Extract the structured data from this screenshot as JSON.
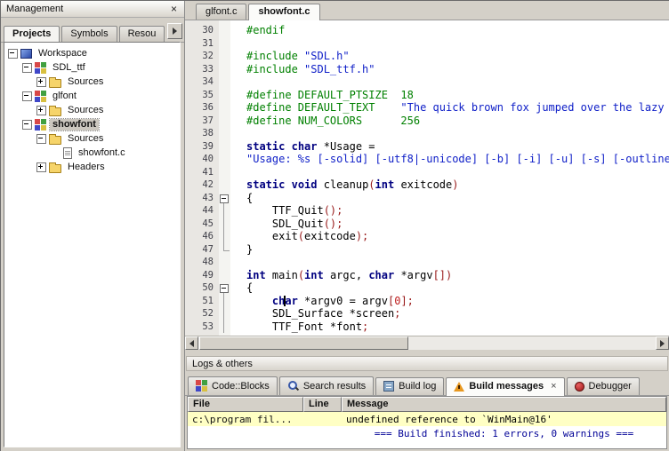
{
  "management": {
    "title": "Management",
    "close_glyph": "×",
    "tabs": [
      {
        "label": "Projects",
        "active": true
      },
      {
        "label": "Symbols",
        "active": false
      },
      {
        "label": "Resou",
        "active": false
      }
    ],
    "tree": [
      {
        "label": "Workspace",
        "depth": 0,
        "icon": "workspace",
        "expand": "minus",
        "bold": false,
        "selected": false
      },
      {
        "label": "SDL_ttf",
        "depth": 1,
        "icon": "project",
        "expand": "minus",
        "bold": false,
        "selected": false
      },
      {
        "label": "Sources",
        "depth": 2,
        "icon": "folder",
        "expand": "plus",
        "bold": false,
        "selected": false
      },
      {
        "label": "glfont",
        "depth": 1,
        "icon": "project",
        "expand": "minus",
        "bold": false,
        "selected": false
      },
      {
        "label": "Sources",
        "depth": 2,
        "icon": "folder",
        "expand": "plus",
        "bold": false,
        "selected": false
      },
      {
        "label": "showfont",
        "depth": 1,
        "icon": "project",
        "expand": "minus",
        "bold": true,
        "selected": true
      },
      {
        "label": "Sources",
        "depth": 2,
        "icon": "folder",
        "expand": "minus",
        "bold": false,
        "selected": false
      },
      {
        "label": "showfont.c",
        "depth": 3,
        "icon": "file",
        "expand": "none",
        "bold": false,
        "selected": false
      },
      {
        "label": "Headers",
        "depth": 2,
        "icon": "folder",
        "expand": "plus",
        "bold": false,
        "selected": false
      }
    ]
  },
  "editor": {
    "tabs": [
      {
        "label": "glfont.c",
        "active": false
      },
      {
        "label": "showfont.c",
        "active": true
      }
    ],
    "syntax": {
      "pre": "#008000",
      "kw": "#000080",
      "str": "#1020c8",
      "op": "#981818",
      "num": "#c02020",
      "pl": "#000000"
    },
    "lines": [
      {
        "num": 30,
        "fold": "",
        "seg": [
          [
            "pre",
            "#endif"
          ]
        ]
      },
      {
        "num": 31,
        "fold": "",
        "seg": []
      },
      {
        "num": 32,
        "fold": "",
        "seg": [
          [
            "pre",
            "#include "
          ],
          [
            "str",
            "\"SDL.h\""
          ]
        ]
      },
      {
        "num": 33,
        "fold": "",
        "seg": [
          [
            "pre",
            "#include "
          ],
          [
            "str",
            "\"SDL_ttf.h\""
          ]
        ]
      },
      {
        "num": 34,
        "fold": "",
        "seg": []
      },
      {
        "num": 35,
        "fold": "",
        "seg": [
          [
            "pre",
            "#define DEFAULT_PTSIZE  18"
          ]
        ]
      },
      {
        "num": 36,
        "fold": "",
        "seg": [
          [
            "pre",
            "#define DEFAULT_TEXT    "
          ],
          [
            "str",
            "\"The quick brown fox jumped over the lazy dog\""
          ]
        ]
      },
      {
        "num": 37,
        "fold": "",
        "seg": [
          [
            "pre",
            "#define NUM_COLORS      256"
          ]
        ]
      },
      {
        "num": 38,
        "fold": "",
        "seg": []
      },
      {
        "num": 39,
        "fold": "",
        "seg": [
          [
            "kw",
            "static"
          ],
          [
            "pl",
            " "
          ],
          [
            "kw",
            "char"
          ],
          [
            "pl",
            " *Usage ="
          ]
        ]
      },
      {
        "num": 40,
        "fold": "",
        "seg": [
          [
            "str",
            "\"Usage: %s [-solid] [-utf8|-unicode] [-b] [-i] [-u] [-s] [-outline N] <font>.ttf [ptsize] [text]\""
          ]
        ]
      },
      {
        "num": 41,
        "fold": "",
        "seg": []
      },
      {
        "num": 42,
        "fold": "",
        "seg": [
          [
            "kw",
            "static"
          ],
          [
            "pl",
            " "
          ],
          [
            "kw",
            "void"
          ],
          [
            "pl",
            " cleanup"
          ],
          [
            "op",
            "("
          ],
          [
            "kw",
            "int"
          ],
          [
            "pl",
            " exitcode"
          ],
          [
            "op",
            ")"
          ]
        ]
      },
      {
        "num": 43,
        "fold": "box",
        "seg": [
          [
            "pl",
            "{"
          ]
        ]
      },
      {
        "num": 44,
        "fold": "bar",
        "seg": [
          [
            "pl",
            "    TTF_Quit"
          ],
          [
            "op",
            "();"
          ]
        ]
      },
      {
        "num": 45,
        "fold": "bar",
        "seg": [
          [
            "pl",
            "    SDL_Quit"
          ],
          [
            "op",
            "();"
          ]
        ]
      },
      {
        "num": 46,
        "fold": "bar",
        "seg": [
          [
            "pl",
            "    exit"
          ],
          [
            "op",
            "("
          ],
          [
            "pl",
            "exitcode"
          ],
          [
            "op",
            ");"
          ]
        ]
      },
      {
        "num": 47,
        "fold": "end",
        "seg": [
          [
            "pl",
            "}"
          ]
        ]
      },
      {
        "num": 48,
        "fold": "",
        "seg": []
      },
      {
        "num": 49,
        "fold": "",
        "seg": [
          [
            "kw",
            "int"
          ],
          [
            "pl",
            " main"
          ],
          [
            "op",
            "("
          ],
          [
            "kw",
            "int"
          ],
          [
            "pl",
            " argc, "
          ],
          [
            "kw",
            "char"
          ],
          [
            "pl",
            " *argv"
          ],
          [
            "op",
            "[])"
          ]
        ]
      },
      {
        "num": 50,
        "fold": "box",
        "seg": [
          [
            "pl",
            "{"
          ]
        ]
      },
      {
        "num": 51,
        "fold": "bar",
        "seg": [
          [
            "pl",
            "    "
          ],
          [
            "kw",
            "ch"
          ],
          [
            "caret",
            ""
          ],
          [
            "kw",
            "ar"
          ],
          [
            "pl",
            " *argv0 = argv"
          ],
          [
            "op",
            "["
          ],
          [
            "num",
            "0"
          ],
          [
            "op",
            "];"
          ]
        ]
      },
      {
        "num": 52,
        "fold": "bar",
        "seg": [
          [
            "pl",
            "    SDL_Surface *screen"
          ],
          [
            "op",
            ";"
          ]
        ]
      },
      {
        "num": 53,
        "fold": "bar",
        "seg": [
          [
            "pl",
            "    TTF_Font *font"
          ],
          [
            "op",
            ";"
          ]
        ]
      }
    ]
  },
  "logs": {
    "title": "Logs & others",
    "tabs": [
      {
        "label": "Code::Blocks",
        "icon": "codeblocks",
        "active": false,
        "close": ""
      },
      {
        "label": "Search results",
        "icon": "search",
        "active": false,
        "close": ""
      },
      {
        "label": "Build log",
        "icon": "buildlog",
        "active": false,
        "close": ""
      },
      {
        "label": "Build messages",
        "icon": "buildmsg",
        "active": true,
        "close": "×"
      },
      {
        "label": "Debugger",
        "icon": "debugger",
        "active": false,
        "close": ""
      }
    ],
    "columns": [
      "File",
      "Line",
      "Message"
    ],
    "rows": [
      {
        "file": "c:\\program fil...",
        "line": "",
        "message": "undefined reference to `WinMain@16'",
        "bg": "#ffffc4",
        "color": "#000000",
        "align": "left"
      },
      {
        "file": "",
        "line": "",
        "message": "=== Build finished: 1 errors, 0 warnings ===",
        "bg": "#ffffff",
        "color": "#000096",
        "align": "center"
      }
    ]
  }
}
